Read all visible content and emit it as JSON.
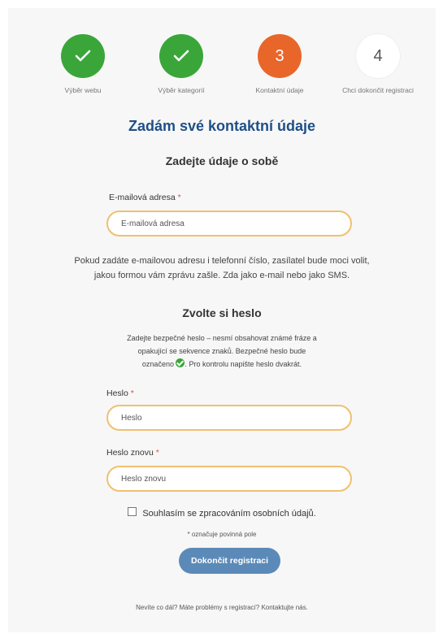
{
  "steps": [
    {
      "state": "done",
      "label": "Výběr webu",
      "icon": "check-icon"
    },
    {
      "state": "done",
      "label": "Výběr kategorií",
      "icon": "check-icon"
    },
    {
      "state": "active",
      "number": "3",
      "label": "Kontaktní údaje"
    },
    {
      "state": "todo",
      "number": "4",
      "label": "Chci dokončit registraci"
    }
  ],
  "title": "Zadám své kontaktní údaje",
  "subtitle": "Zadejte údaje o sobě",
  "email": {
    "label": "E-mailová adresa",
    "required_mark": "*",
    "placeholder": "E-mailová adresa"
  },
  "info_text_line1": "Pokud zadáte e-mailovou adresu i telefonní číslo, zasílatel bude moci volit,",
  "info_text_line2": "jakou formou vám zprávu zašle. Zda jako e-mail nebo jako SMS.",
  "password_section": {
    "title": "Zvolte si heslo",
    "info_line1": "Zadejte bezpečné heslo – nesmí obsahovat známé fráze a",
    "info_line2": "opakující se sekvence znaků. Bezpečné heslo bude",
    "info_line3_before": "označeno",
    "info_line3_after": ". Pro kontrolu napište heslo dvakrát."
  },
  "password": {
    "label": "Heslo",
    "required_mark": "*",
    "placeholder": "Heslo"
  },
  "password_again": {
    "label": "Heslo znovu",
    "required_mark": "*",
    "placeholder": "Heslo znovu"
  },
  "consent_label": "Souhlasím se zpracováním osobních údajů.",
  "required_note": "* označuje povinná pole",
  "submit_label": "Dokončit registraci",
  "help_text": "Nevíte co dál? Máte problémy s registrací? Kontaktujte nás.",
  "colors": {
    "done": "#3aa63a",
    "active": "#e8662a",
    "title": "#1f4f86",
    "input_border": "#f0c070",
    "button": "#5b8ab8",
    "required": "#e05050"
  }
}
